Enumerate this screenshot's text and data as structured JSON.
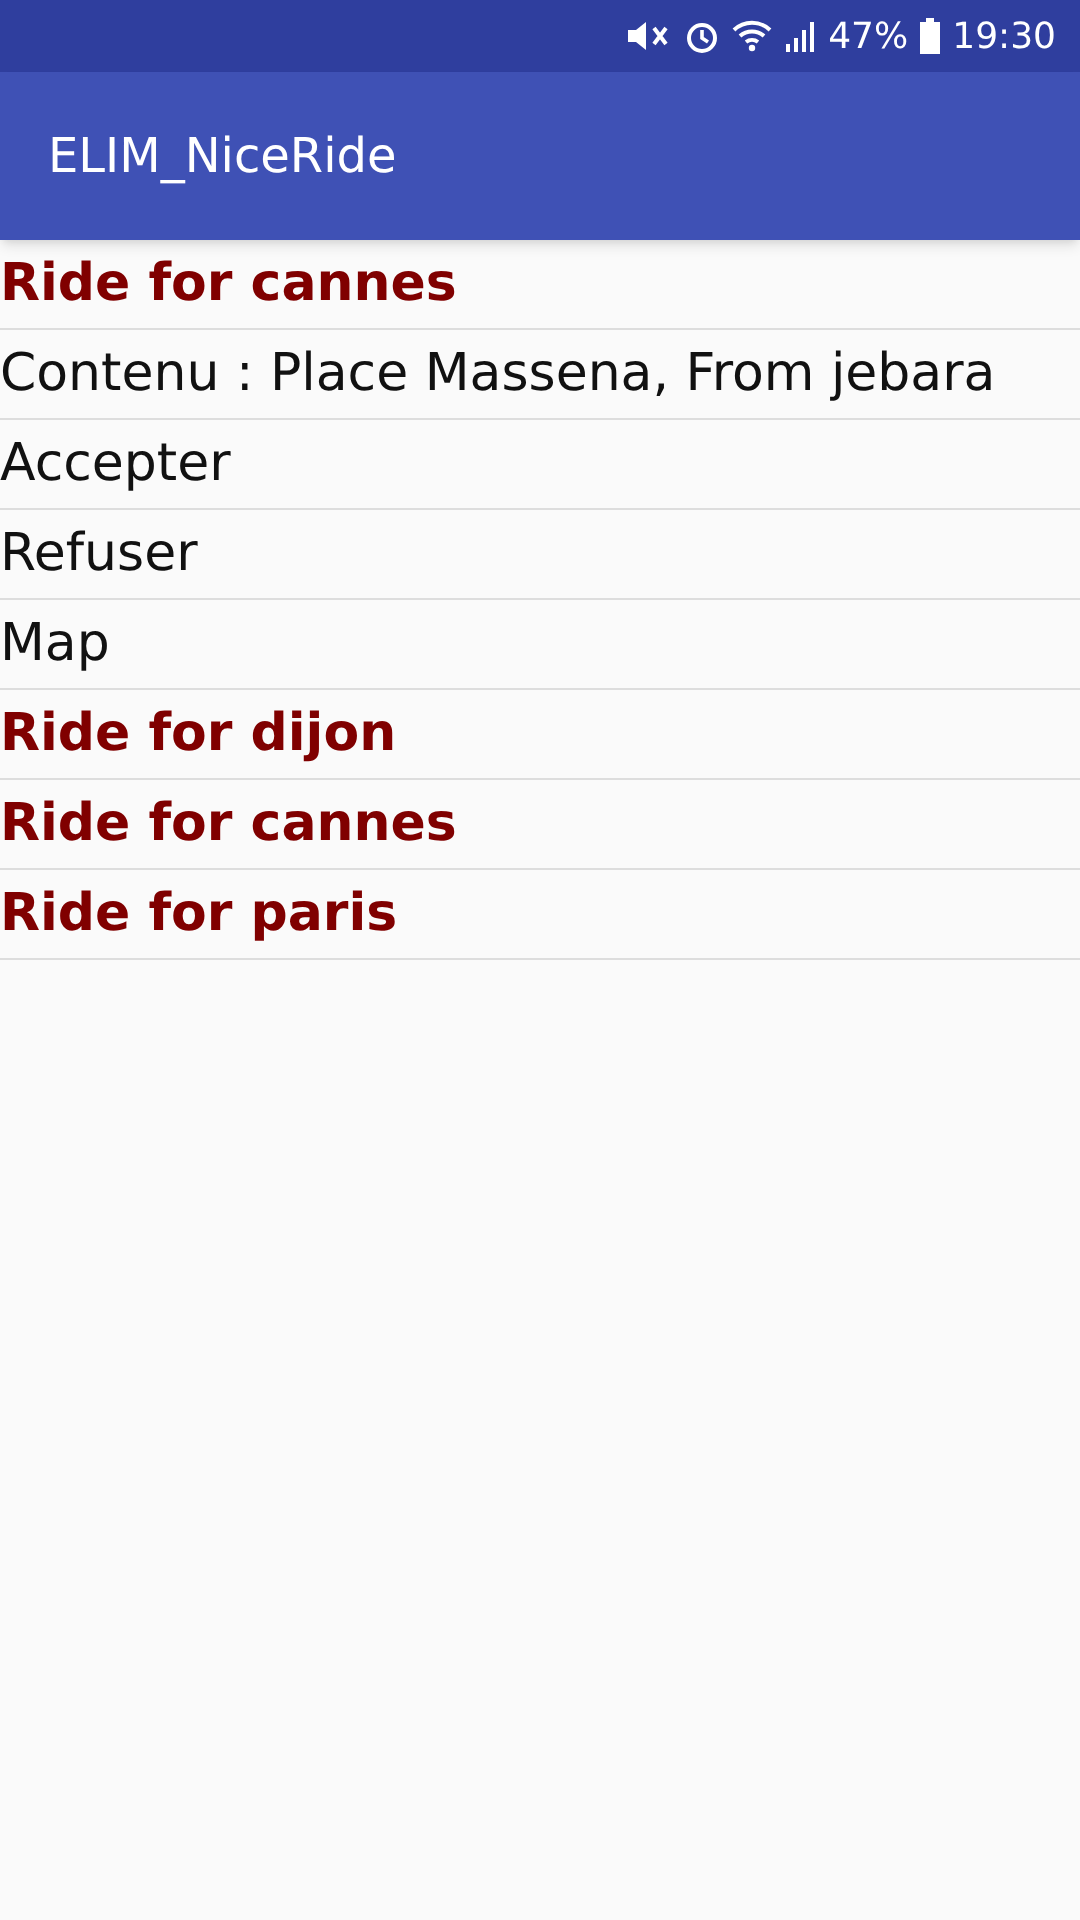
{
  "status_bar": {
    "battery": "47%",
    "time": "19:30"
  },
  "app_bar": {
    "title": "ELIM_NiceRide"
  },
  "rides": [
    {
      "title": "Ride for cannes",
      "children": [
        {
          "label": "Contenu : Place Massena, From jebara"
        },
        {
          "label": "Accepter"
        },
        {
          "label": "Refuser"
        },
        {
          "label": "Map"
        }
      ]
    },
    {
      "title": "Ride for dijon"
    },
    {
      "title": "Ride for cannes"
    },
    {
      "title": "Ride for paris"
    }
  ]
}
